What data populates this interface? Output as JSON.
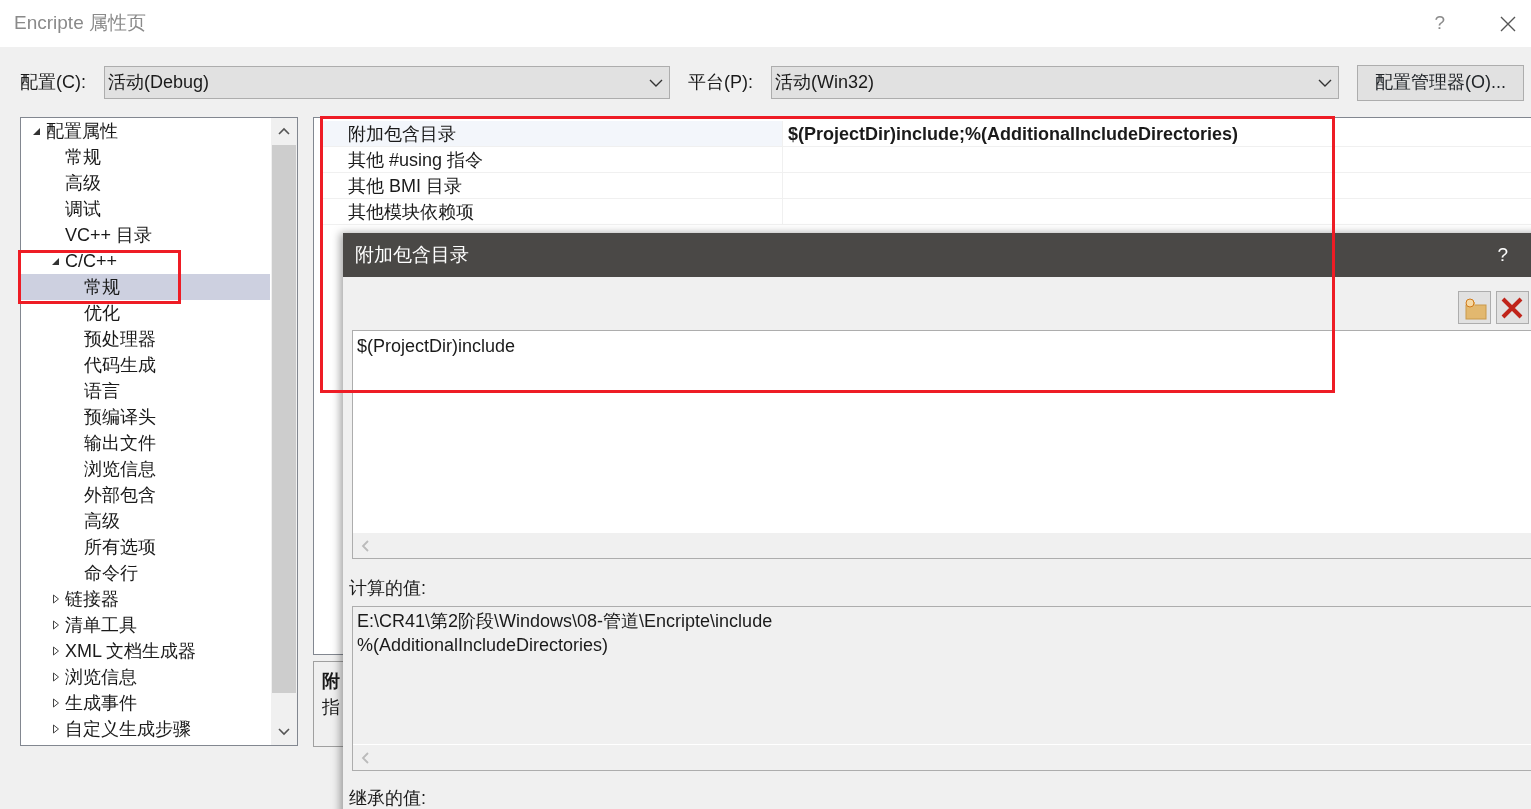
{
  "window": {
    "title": "Encripte 属性页",
    "help": "?"
  },
  "config": {
    "label": "配置(C):",
    "value": "活动(Debug)"
  },
  "platform": {
    "label": "平台(P):",
    "value": "活动(Win32)"
  },
  "manager_button": "配置管理器(O)...",
  "tree": [
    {
      "label": "配置属性",
      "expanded": true,
      "selected": false,
      "children": [
        {
          "label": "常规",
          "selected": false
        },
        {
          "label": "高级",
          "selected": false
        },
        {
          "label": "调试",
          "selected": false
        },
        {
          "label": "VC++ 目录",
          "selected": false
        },
        {
          "label": "C/C++",
          "expanded": true,
          "selected": false,
          "children": [
            {
              "label": "常规",
              "selected": true
            },
            {
              "label": "优化",
              "selected": false
            },
            {
              "label": "预处理器",
              "selected": false
            },
            {
              "label": "代码生成",
              "selected": false
            },
            {
              "label": "语言",
              "selected": false
            },
            {
              "label": "预编译头",
              "selected": false
            },
            {
              "label": "输出文件",
              "selected": false
            },
            {
              "label": "浏览信息",
              "selected": false
            },
            {
              "label": "外部包含",
              "selected": false
            },
            {
              "label": "高级",
              "selected": false
            },
            {
              "label": "所有选项",
              "selected": false
            },
            {
              "label": "命令行",
              "selected": false
            }
          ]
        },
        {
          "label": "链接器",
          "expanded": false,
          "selected": false
        },
        {
          "label": "清单工具",
          "expanded": false,
          "selected": false
        },
        {
          "label": "XML 文档生成器",
          "expanded": false,
          "selected": false
        },
        {
          "label": "浏览信息",
          "expanded": false,
          "selected": false
        },
        {
          "label": "生成事件",
          "expanded": false,
          "selected": false
        },
        {
          "label": "自定义生成步骤",
          "expanded": false,
          "selected": false
        }
      ]
    }
  ],
  "properties": [
    {
      "name": "附加包含目录",
      "value": "$(ProjectDir)include;%(AdditionalIncludeDirectories)",
      "selected": true
    },
    {
      "name": "其他 #using 指令",
      "selected": false
    },
    {
      "name": "其他 BMI 目录",
      "selected": false
    },
    {
      "name": "其他模块依赖项",
      "selected": false
    }
  ],
  "description": {
    "title": "附",
    "text": "指"
  },
  "dialog": {
    "title": "附加包含目录",
    "help": "?",
    "entries": [
      "$(ProjectDir)include"
    ],
    "computed_label": "计算的值:",
    "computed": [
      "E:\\CR41\\第2阶段\\Windows\\08-管道\\Encripte\\include",
      "%(AdditionalIncludeDirectories)"
    ],
    "inherited_label": "继承的值:"
  },
  "annotations": [
    {
      "kind": "rectangle",
      "color": "#ee1c25"
    },
    {
      "kind": "rectangle",
      "color": "#ee1c25"
    }
  ]
}
